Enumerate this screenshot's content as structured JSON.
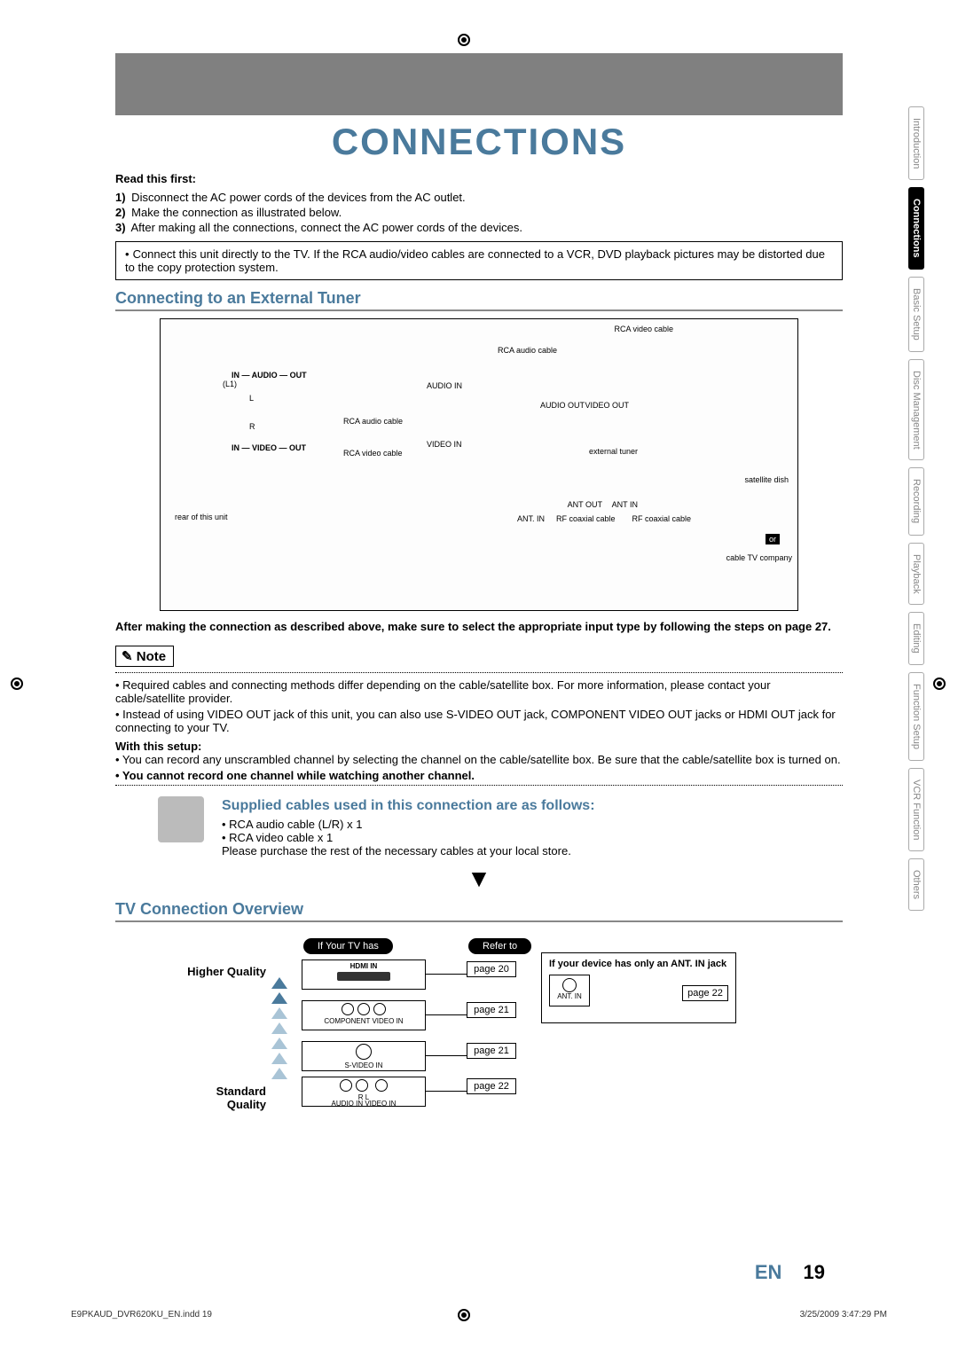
{
  "title": "CONNECTIONS",
  "read_first_label": "Read this first:",
  "steps": [
    {
      "num": "1)",
      "text": " Disconnect the AC power cords of the devices from the AC outlet."
    },
    {
      "num": "2)",
      "text": " Make the connection as illustrated below."
    },
    {
      "num": "3)",
      "text": " After making all the connections, connect the AC power cords of the devices."
    }
  ],
  "info_box": "Connect this unit directly to the TV. If the RCA audio/video cables are connected to a VCR, DVD playback pictures may be distorted due to the copy protection system.",
  "section1": "Connecting to an External Tuner",
  "diagram_labels": {
    "rca_video_cable_top": "RCA video cable",
    "rca_audio_cable": "RCA audio cable",
    "audio_in": "AUDIO IN",
    "video_in": "VIDEO IN",
    "in_audio_out": "IN — AUDIO — OUT",
    "in_video_out": "IN — VIDEO — OUT",
    "rca_audio_cable2": "RCA audio cable",
    "rca_video_cable2": "RCA video cable",
    "rear": "rear of this unit",
    "external_tuner": "external tuner",
    "audio_out": "AUDIO OUT",
    "video_out": "VIDEO OUT",
    "ant_out": "ANT OUT",
    "ant_in": "ANT IN",
    "ant_in_tv": "ANT. IN",
    "rf1": "RF coaxial cable",
    "rf2": "RF coaxial cable",
    "satellite": "satellite dish",
    "or": "or",
    "cable_tv": "cable TV company",
    "l": "L",
    "r": "R",
    "l1": "(L1)"
  },
  "after_diagram": "After making the connection as described above, make sure to select the appropriate input type by following the steps on page 27.",
  "note_label": "Note",
  "notes": [
    "• Required cables and connecting methods differ depending on the cable/satellite box. For more information, please contact your cable/satellite provider.",
    "• Instead of using VIDEO OUT jack of this unit, you can also use S-VIDEO OUT jack, COMPONENT VIDEO OUT jacks or HDMI OUT jack for connecting to your TV."
  ],
  "with_setup": "With this setup:",
  "with_setup_items": [
    "• You can record any unscrambled channel by selecting the channel on the cable/satellite box. Be sure that the cable/satellite box is turned on.",
    "• You cannot record one channel while watching another channel."
  ],
  "supplied": {
    "title": "Supplied cables used in this connection are as follows:",
    "items": [
      "• RCA audio cable (L/R) x 1",
      "• RCA video cable x 1"
    ],
    "footer": "Please purchase the rest of the necessary cables at your local store."
  },
  "section2": "TV Connection Overview",
  "tv_overview": {
    "higher": "Higher Quality",
    "standard": "Standard Quality",
    "if_tv_has": "If Your TV has",
    "refer_to": "Refer to",
    "rows": [
      {
        "label": "HDMI IN",
        "page": "page 20"
      },
      {
        "label": "COMPONENT VIDEO IN",
        "page": "page 21"
      },
      {
        "label": "S-VIDEO IN",
        "page": "page 21"
      },
      {
        "label": "AUDIO IN   VIDEO IN",
        "sub": "R   L",
        "page": "page 22"
      }
    ],
    "ant_box": {
      "heading": "If your device has only an ANT. IN jack",
      "jack_label": "ANT. IN",
      "page": "page 22"
    }
  },
  "side_tabs": [
    "Introduction",
    "Connections",
    "Basic Setup",
    "Disc Management",
    "Recording",
    "Playback",
    "Editing",
    "Function Setup",
    "VCR Function",
    "Others"
  ],
  "active_tab_index": 1,
  "page_footer": {
    "lang": "EN",
    "num": "19"
  },
  "print_footer": {
    "left": "E9PKAUD_DVR620KU_EN.indd   19",
    "right": "3/25/2009   3:47:29 PM"
  }
}
